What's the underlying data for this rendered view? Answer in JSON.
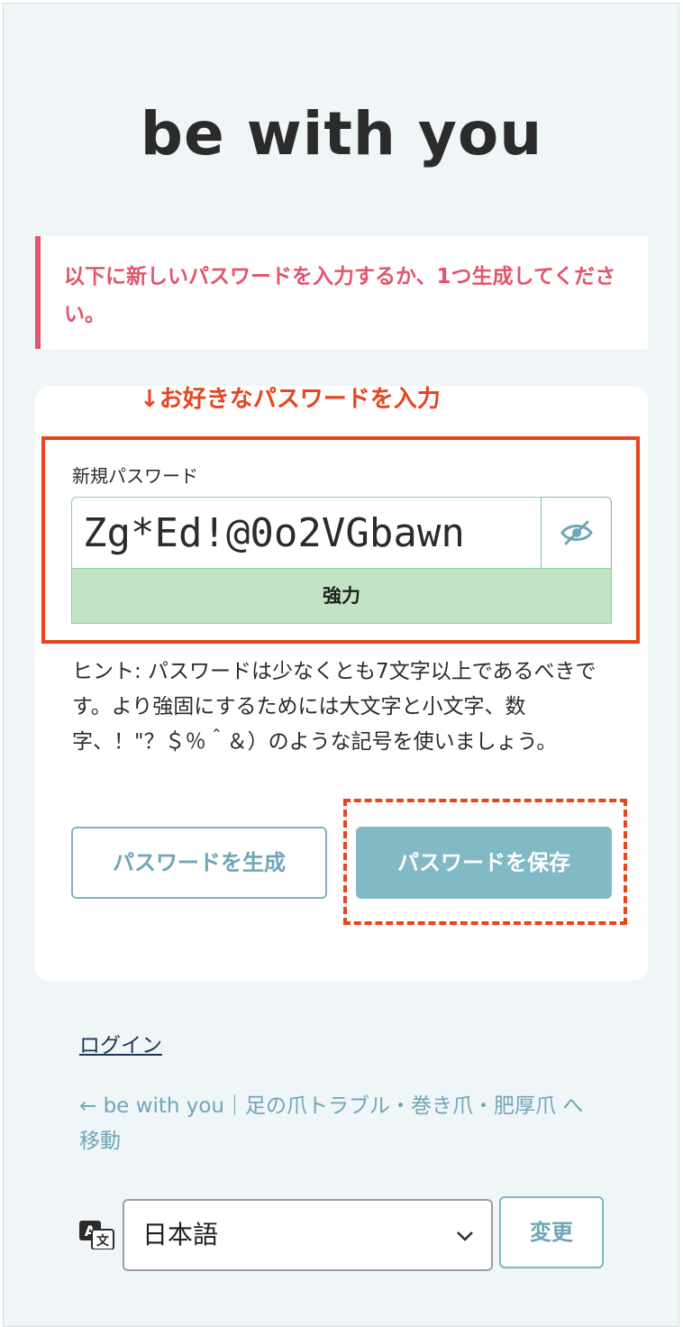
{
  "header": {
    "logo_text": "be with you"
  },
  "notice": {
    "text": "以下に新しいパスワードを入力するか、1つ生成してください。"
  },
  "annotation": {
    "text": "↓お好きなパスワードを入力"
  },
  "form": {
    "new_password_label": "新規パスワード",
    "password_value": "Zg*Ed!@0o2VGbawn",
    "strength_label": "強力",
    "hint": "ヒント: パスワードは少なくとも7文字以上であるべきです。より強固にするためには大文字と小文字、数字、！\"？＄％＾＆）のような記号を使いましょう。",
    "generate_label": "パスワードを生成",
    "save_label": "パスワードを保存",
    "toggle_icon": "eye-slash-icon"
  },
  "footer": {
    "login_label": "ログイン",
    "back_label": "← be with you｜足の爪トラブル・巻き爪・肥厚爪 へ移動",
    "language_value": "日本語",
    "change_label": "変更",
    "translate_icon": "translate-icon"
  },
  "colors": {
    "accent": "#81b9c5",
    "notice": "#e2556b",
    "annotation": "#e8441d",
    "strength_bg": "#c2e4c4"
  }
}
